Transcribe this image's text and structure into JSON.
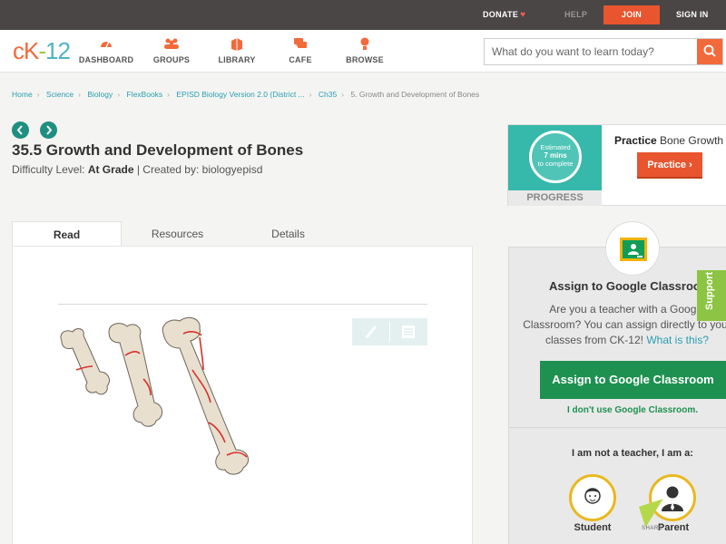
{
  "topbar": {
    "donate": "DONATE",
    "help": "HELP",
    "join": "JOIN",
    "signin": "SIGN IN"
  },
  "header": {
    "logo": {
      "c": "c",
      "k": "K",
      "dash": "-",
      "num": "12"
    },
    "nav": [
      {
        "label": "DASHBOARD",
        "icon": "dashboard-icon"
      },
      {
        "label": "GROUPS",
        "icon": "groups-icon"
      },
      {
        "label": "LIBRARY",
        "icon": "library-icon"
      },
      {
        "label": "CAFE",
        "icon": "cafe-icon"
      },
      {
        "label": "BROWSE",
        "icon": "browse-icon"
      }
    ],
    "search": {
      "placeholder": "What do you want to learn today?",
      "value": ""
    }
  },
  "breadcrumb": [
    "Home",
    "Science",
    "Biology",
    "FlexBooks",
    "EPISD Biology Version 2.0 (District ...",
    "Ch35",
    "5. Growth and Development of Bones"
  ],
  "article": {
    "title": "35.5 Growth and Development of Bones",
    "difficulty_prefix": "Difficulty Level: ",
    "difficulty": "At Grade",
    "created_by": " | Created by: biologyepisd"
  },
  "tabs": [
    "Read",
    "Resources",
    "Details"
  ],
  "practice": {
    "estimated": "Estimated",
    "mins": "7 mins",
    "complete": "to complete",
    "progress": "PROGRESS",
    "title_bold": "Practice",
    "title_rest": " Bone Growth",
    "button": "Practice"
  },
  "classroom": {
    "heading": "Assign to Google Classroom",
    "body_1": "Are you a teacher with a Google",
    "body_2": "Classroom? You can assign directly to your",
    "body_3": "classes from CK-12! ",
    "link": "What is this?",
    "assign_button": "Assign to Google Classroom",
    "dont_use": "I don't use Google Classroom.",
    "not_teacher": "I am not a teacher, I am a:",
    "student": "Student",
    "parent": "Parent"
  },
  "support": "Support",
  "share": "SHARE",
  "colors": {
    "accent": "#e8552f",
    "teal": "#36b8aa",
    "green": "#1e9150",
    "link": "#2a9fb0"
  }
}
